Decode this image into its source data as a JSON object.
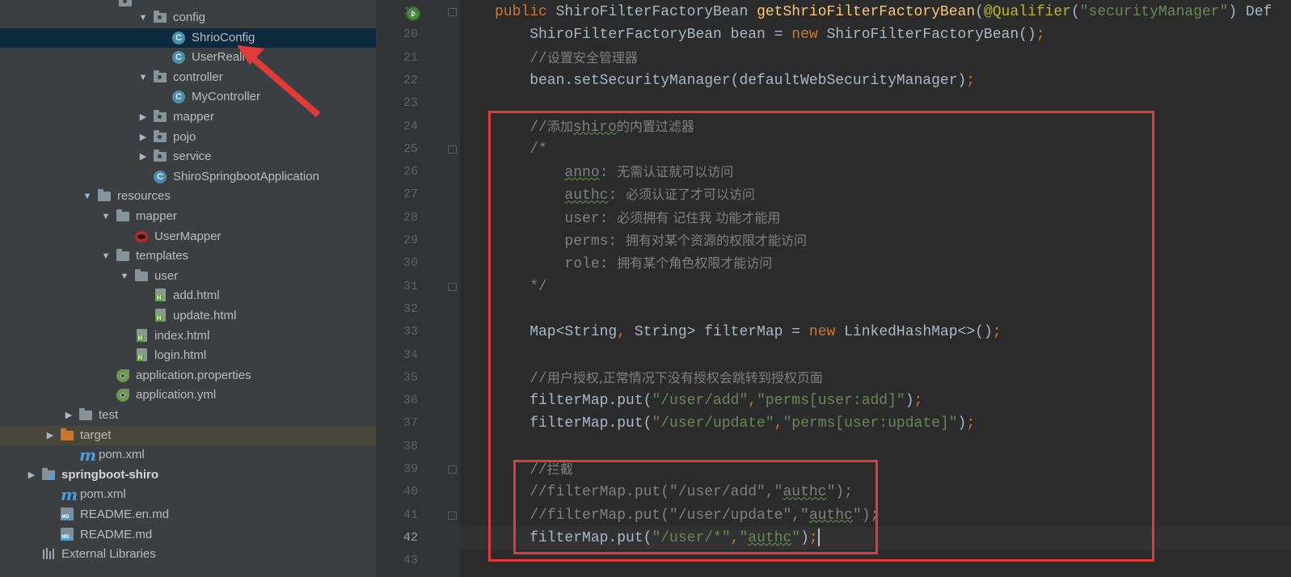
{
  "project_tree": {
    "items": [
      {
        "label": "config",
        "icon": "package-folder-icon",
        "arrow": "▼",
        "indent": 1
      },
      {
        "label": "ShrioConfig",
        "icon": "class-icon",
        "arrow": "",
        "indent": 2,
        "selected": true
      },
      {
        "label": "UserRealm",
        "icon": "class-icon",
        "arrow": "",
        "indent": 2
      },
      {
        "label": "controller",
        "icon": "package-folder-icon",
        "arrow": "▼",
        "indent": 1
      },
      {
        "label": "MyController",
        "icon": "class-icon",
        "arrow": "",
        "indent": 2
      },
      {
        "label": "mapper",
        "icon": "package-folder-icon",
        "arrow": "▶",
        "indent": 1
      },
      {
        "label": "pojo",
        "icon": "package-folder-icon",
        "arrow": "▶",
        "indent": 1
      },
      {
        "label": "service",
        "icon": "package-folder-icon",
        "arrow": "▶",
        "indent": 1
      },
      {
        "label": "ShiroSpringbootApplication",
        "icon": "spring-boot-class-icon",
        "arrow": "",
        "indent": 1
      },
      {
        "label": "resources",
        "icon": "resources-folder-icon",
        "arrow": "▼",
        "indent": -2
      },
      {
        "label": "mapper",
        "icon": "folder-icon",
        "arrow": "▼",
        "indent": -1
      },
      {
        "label": "UserMapper",
        "icon": "mybatis-xml-icon",
        "arrow": "",
        "indent": 0
      },
      {
        "label": "templates",
        "icon": "folder-icon",
        "arrow": "▼",
        "indent": -1
      },
      {
        "label": "user",
        "icon": "folder-icon",
        "arrow": "▼",
        "indent": 0
      },
      {
        "label": "add.html",
        "icon": "html-file-icon",
        "arrow": "",
        "indent": 1
      },
      {
        "label": "update.html",
        "icon": "html-file-icon",
        "arrow": "",
        "indent": 1
      },
      {
        "label": "index.html",
        "icon": "html-file-icon",
        "arrow": "",
        "indent": 0
      },
      {
        "label": "login.html",
        "icon": "html-file-icon",
        "arrow": "",
        "indent": 0
      },
      {
        "label": "application.properties",
        "icon": "spring-config-icon",
        "arrow": "",
        "indent": -1
      },
      {
        "label": "application.yml",
        "icon": "spring-config-icon",
        "arrow": "",
        "indent": -1
      },
      {
        "label": "test",
        "icon": "folder-icon",
        "arrow": "▶",
        "indent": -3
      },
      {
        "label": "target",
        "icon": "excluded-folder-icon",
        "arrow": "▶",
        "indent": -4,
        "excluded": true
      },
      {
        "label": "pom.xml",
        "icon": "maven-icon",
        "arrow": "",
        "indent": -3
      },
      {
        "label": "springboot-shiro",
        "icon": "module-folder-icon",
        "arrow": "▶",
        "indent": -5,
        "bold": true
      },
      {
        "label": "pom.xml",
        "icon": "maven-icon",
        "arrow": "",
        "indent": -4
      },
      {
        "label": "README.en.md",
        "icon": "markdown-icon",
        "arrow": "",
        "indent": -4
      },
      {
        "label": "README.md",
        "icon": "markdown-icon",
        "arrow": "",
        "indent": -4
      },
      {
        "label": "External Libraries",
        "icon": "libraries-icon",
        "arrow": "",
        "indent": -5
      }
    ]
  },
  "editor": {
    "current_line": "42",
    "lines": [
      {
        "n": "19",
        "t": [
          [
            "kw",
            "public "
          ],
          [
            "",
            "ShiroFilterFactoryBean "
          ],
          [
            "fn",
            "getShrioFilterFactoryBean"
          ],
          [
            "",
            "("
          ],
          [
            "ann",
            "@Qualifier"
          ],
          [
            "",
            "("
          ],
          [
            "str",
            "\"securityManager\""
          ],
          [
            "",
            ") Def"
          ]
        ]
      },
      {
        "n": "20",
        "t": [
          [
            "",
            "    ShiroFilterFactoryBean bean = "
          ],
          [
            "kw",
            "new "
          ],
          [
            "",
            "ShiroFilterFactoryBean()"
          ],
          [
            "kw",
            ";"
          ]
        ]
      },
      {
        "n": "21",
        "t": [
          [
            "cm",
            "    //"
          ],
          [
            "cmzh",
            "设置安全管理器"
          ]
        ]
      },
      {
        "n": "22",
        "t": [
          [
            "",
            "    bean.setSecurityManager(defaultWebSecurityManager)"
          ],
          [
            "kw",
            ";"
          ]
        ]
      },
      {
        "n": "23",
        "t": []
      },
      {
        "n": "24",
        "t": [
          [
            "cm",
            "    //"
          ],
          [
            "cmzh",
            "添加"
          ],
          [
            "cmtypo",
            "shiro"
          ],
          [
            "cmzh",
            "的内置过滤器"
          ]
        ]
      },
      {
        "n": "25",
        "t": [
          [
            "cm",
            "    /*"
          ]
        ]
      },
      {
        "n": "26",
        "t": [
          [
            "cm",
            "        "
          ],
          [
            "cmtypo",
            "anno"
          ],
          [
            "cm",
            ": "
          ],
          [
            "cmzh",
            "无需认证就可以访问"
          ]
        ]
      },
      {
        "n": "27",
        "t": [
          [
            "cm",
            "        "
          ],
          [
            "cmtypo",
            "authc"
          ],
          [
            "cm",
            ": "
          ],
          [
            "cmzh",
            "必须认证了才可以访问"
          ]
        ]
      },
      {
        "n": "28",
        "t": [
          [
            "cm",
            "        user: "
          ],
          [
            "cmzh",
            "必须拥有 记住我 功能才能用"
          ]
        ]
      },
      {
        "n": "29",
        "t": [
          [
            "cm",
            "        perms: "
          ],
          [
            "cmzh",
            "拥有对某个资源的权限才能访问"
          ]
        ]
      },
      {
        "n": "30",
        "t": [
          [
            "cm",
            "        role: "
          ],
          [
            "cmzh",
            "拥有某个角色权限才能访问"
          ]
        ]
      },
      {
        "n": "31",
        "t": [
          [
            "cm",
            "    */"
          ]
        ]
      },
      {
        "n": "32",
        "t": []
      },
      {
        "n": "33",
        "t": [
          [
            "",
            "    Map<String"
          ],
          [
            "kw",
            ", "
          ],
          [
            "",
            "String> filterMap = "
          ],
          [
            "kw",
            "new "
          ],
          [
            "",
            "LinkedHashMap<>()"
          ],
          [
            "kw",
            ";"
          ]
        ]
      },
      {
        "n": "34",
        "t": []
      },
      {
        "n": "35",
        "t": [
          [
            "cm",
            "    //"
          ],
          [
            "cmzh",
            "用户授权,正常情况下没有授权会跳转到授权页面"
          ]
        ]
      },
      {
        "n": "36",
        "t": [
          [
            "",
            "    filterMap.put("
          ],
          [
            "str",
            "\"/user/add\""
          ],
          [
            "kw",
            ","
          ],
          [
            "str",
            "\"perms[user:add]\""
          ],
          [
            "",
            ")"
          ],
          [
            "kw",
            ";"
          ]
        ]
      },
      {
        "n": "37",
        "t": [
          [
            "",
            "    filterMap.put("
          ],
          [
            "str",
            "\"/user/update\""
          ],
          [
            "kw",
            ","
          ],
          [
            "str",
            "\"perms[user:update]\""
          ],
          [
            "",
            ")"
          ],
          [
            "kw",
            ";"
          ]
        ]
      },
      {
        "n": "38",
        "t": []
      },
      {
        "n": "39",
        "t": [
          [
            "cm",
            "    //"
          ],
          [
            "cmzh",
            "拦截"
          ]
        ]
      },
      {
        "n": "40",
        "t": [
          [
            "cm",
            "    //filterMap.put(\"/user/add\",\""
          ],
          [
            "cmtypo",
            "authc"
          ],
          [
            "cm",
            "\");"
          ]
        ]
      },
      {
        "n": "41",
        "t": [
          [
            "cm",
            "    //filterMap.put(\"/user/update\",\""
          ],
          [
            "cmtypo",
            "authc"
          ],
          [
            "cm",
            "\");"
          ]
        ]
      },
      {
        "n": "42",
        "t": [
          [
            "",
            "    filterMap.put("
          ],
          [
            "str",
            "\"/user/*\""
          ],
          [
            "kw",
            ","
          ],
          [
            "str",
            "\""
          ],
          [
            "strtypo",
            "authc"
          ],
          [
            "str",
            "\""
          ],
          [
            "",
            ")"
          ],
          [
            "kw",
            ";"
          ],
          [
            "caret",
            ""
          ]
        ]
      },
      {
        "n": "43",
        "t": []
      }
    ]
  },
  "colors": {
    "highlight_box": "#e03a3a",
    "keyword": "#cc7832",
    "string": "#6a8759",
    "comment": "#808080",
    "method": "#ffc66d",
    "annotation": "#bbb529"
  }
}
